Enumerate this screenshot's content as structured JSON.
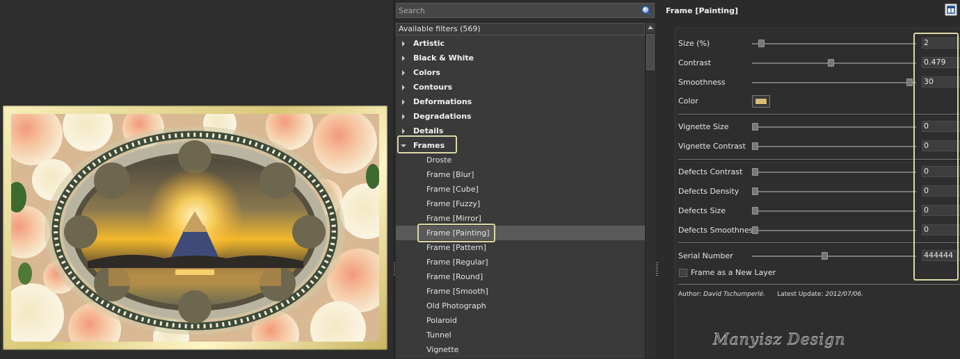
{
  "search": {
    "placeholder": "Search"
  },
  "filter_list": {
    "header": "Available filters (569)",
    "categories": [
      "Artistic",
      "Black & White",
      "Colors",
      "Contours",
      "Deformations",
      "Degradations",
      "Details"
    ],
    "open_category": "Frames",
    "items": [
      "Droste",
      "Frame [Blur]",
      "Frame [Cube]",
      "Frame [Fuzzy]",
      "Frame [Mirror]",
      "Frame [Painting]",
      "Frame [Pattern]",
      "Frame [Regular]",
      "Frame [Round]",
      "Frame [Smooth]",
      "Old Photograph",
      "Polaroid",
      "Tunnel",
      "Vignette"
    ],
    "selected_item": "Frame [Painting]"
  },
  "params": {
    "title": "Frame [Painting]",
    "sliders": [
      {
        "label": "Size (%)",
        "value": "2",
        "level": 0.04
      },
      {
        "label": "Contrast",
        "value": "0.479",
        "level": 0.48
      },
      {
        "label": "Smoothness",
        "value": "30",
        "level": 0.98
      },
      {
        "label": "Vignette Size",
        "value": "0",
        "level": 0
      },
      {
        "label": "Vignette Contrast",
        "value": "0",
        "level": 0
      },
      {
        "label": "Defects Contrast",
        "value": "0",
        "level": 0
      },
      {
        "label": "Defects Density",
        "value": "0",
        "level": 0
      },
      {
        "label": "Defects Size",
        "value": "0",
        "level": 0
      },
      {
        "label": "Defects Smoothness",
        "value": "0",
        "level": 0
      },
      {
        "label": "Serial Number",
        "value": "444444",
        "level": 0.44
      }
    ],
    "color_label": "Color",
    "color_value": "#d6bd74",
    "checkbox_label": "Frame as a New Layer",
    "checkbox_checked": false,
    "author_label": "Author:",
    "author_name": "David Tschumperlé.",
    "update_label": "Latest Update:",
    "update_date": "2012/07/06."
  },
  "watermark": "Manyisz Design",
  "colors": {
    "highlight": "#dcd9a6",
    "frame_gold": "#e8da98"
  }
}
